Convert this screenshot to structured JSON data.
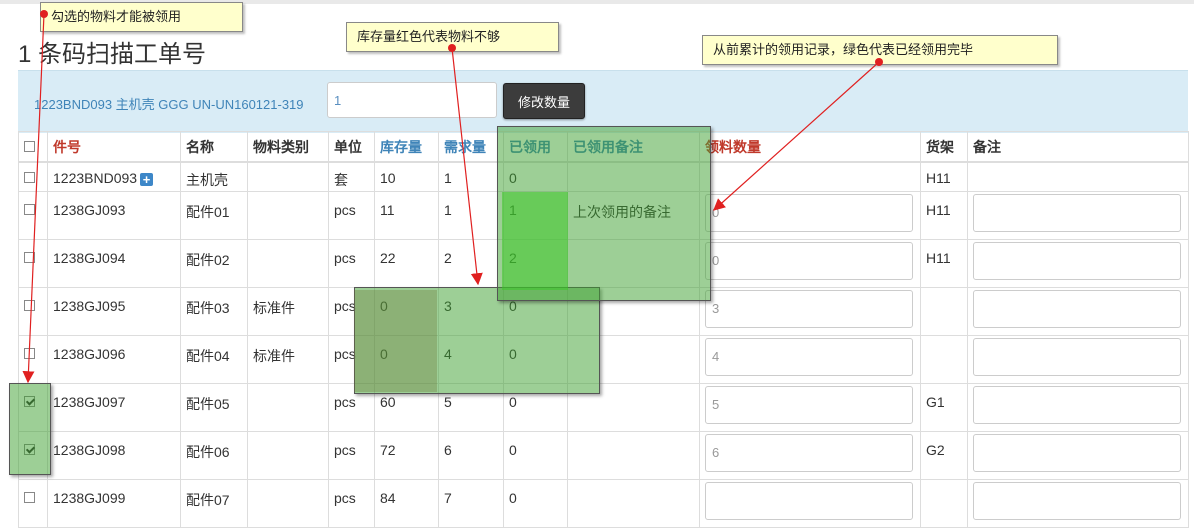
{
  "page": {
    "title": "1 条码扫描工单号"
  },
  "panel": {
    "product_text": "1223BND093 主机壳 GGG UN-UN160121-319",
    "qty_value": "1",
    "button_label": "修改数量"
  },
  "table": {
    "headers": [
      "件号",
      "名称",
      "物料类别",
      "单位",
      "库存量",
      "需求量",
      "已领用",
      "已领用备注",
      "领料数量",
      "货架",
      "备注"
    ],
    "rows": [
      {
        "checked": false,
        "part": "1223BND093",
        "name": "主机壳",
        "cat": "",
        "unit": "套",
        "stock": "10",
        "need": "1",
        "used": "0",
        "used_note": "",
        "qty": "",
        "shelf": "H11",
        "has_inputs": false,
        "has_plus": true
      },
      {
        "checked": false,
        "part": "1238GJ093",
        "name": "配件01",
        "cat": "",
        "unit": "pcs",
        "stock": "11",
        "need": "1",
        "used": "1",
        "used_note": "上次领用的备注",
        "qty": "0",
        "shelf": "H11",
        "has_inputs": true
      },
      {
        "checked": false,
        "part": "1238GJ094",
        "name": "配件02",
        "cat": "",
        "unit": "pcs",
        "stock": "22",
        "need": "2",
        "used": "2",
        "used_note": "",
        "qty": "0",
        "shelf": "H11",
        "has_inputs": true
      },
      {
        "checked": false,
        "part": "1238GJ095",
        "name": "配件03",
        "cat": "标准件",
        "unit": "pcs",
        "stock": "0",
        "need": "3",
        "used": "0",
        "used_note": "",
        "qty": "3",
        "shelf": "",
        "has_inputs": true
      },
      {
        "checked": false,
        "part": "1238GJ096",
        "name": "配件04",
        "cat": "标准件",
        "unit": "pcs",
        "stock": "0",
        "need": "4",
        "used": "0",
        "used_note": "",
        "qty": "4",
        "shelf": "",
        "has_inputs": true
      },
      {
        "checked": true,
        "part": "1238GJ097",
        "name": "配件05",
        "cat": "",
        "unit": "pcs",
        "stock": "60",
        "need": "5",
        "used": "0",
        "used_note": "",
        "qty": "5",
        "shelf": "G1",
        "has_inputs": true
      },
      {
        "checked": true,
        "part": "1238GJ098",
        "name": "配件06",
        "cat": "",
        "unit": "pcs",
        "stock": "72",
        "need": "6",
        "used": "0",
        "used_note": "",
        "qty": "6",
        "shelf": "G2",
        "has_inputs": true
      },
      {
        "checked": false,
        "part": "1238GJ099",
        "name": "配件07",
        "cat": "",
        "unit": "pcs",
        "stock": "84",
        "need": "7",
        "used": "0",
        "used_note": "",
        "qty": "",
        "shelf": "",
        "has_inputs": true
      }
    ]
  },
  "annotations": {
    "checkbox_note": "勾选的物料才能被领用",
    "stock_note": "库存量红色代表物料不够",
    "used_note": "从前累计的领用记录，绿色代表已经领用完毕"
  },
  "colors": {
    "overlay_green": "#3ca02d",
    "header_red": "#c0392b",
    "header_blue": "#3f84b8",
    "panel_bg": "#d9ecf6",
    "button_dark": "#3c3c3c",
    "callout_bg": "#ffffcc",
    "arrow_red": "#e02020"
  }
}
